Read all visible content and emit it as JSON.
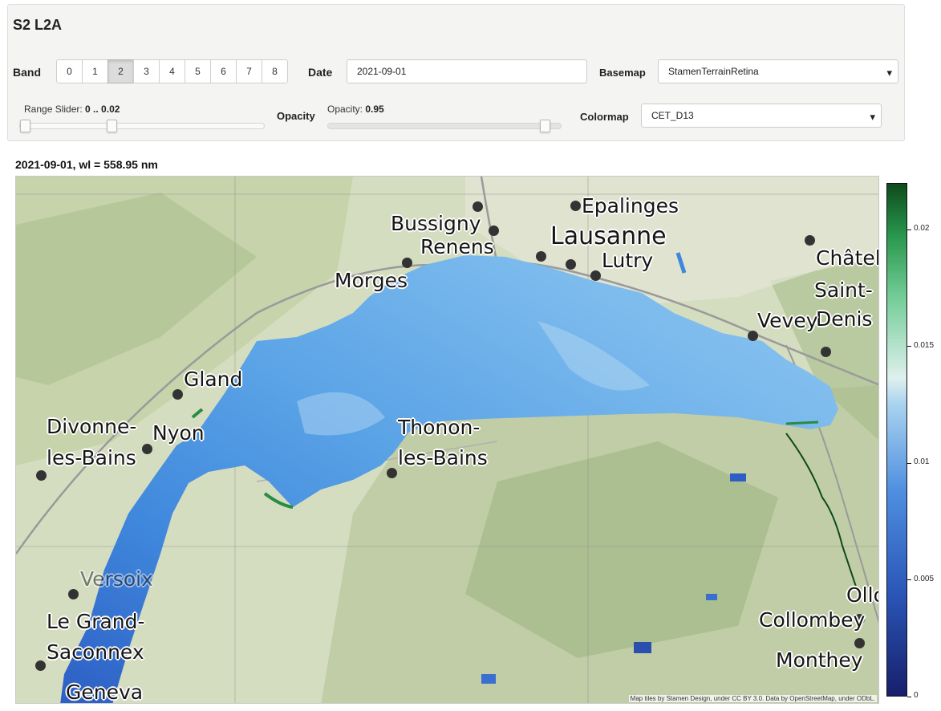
{
  "panel": {
    "title": "S2 L2A",
    "band_label": "Band",
    "bands": [
      "0",
      "1",
      "2",
      "3",
      "4",
      "5",
      "6",
      "7",
      "8"
    ],
    "selected_band": "2",
    "date_label": "Date",
    "date_value": "2021-09-01",
    "basemap_label": "Basemap",
    "basemap_value": "StamenTerrainRetina",
    "range_label": "Range Slider: ",
    "range_value": "0 .. 0.02",
    "opacity_label": "Opacity",
    "opacity_slider_label": "Opacity: ",
    "opacity_value": "0.95",
    "opacity_fraction": 0.95,
    "colormap_label": "Colormap",
    "colormap_value": "CET_D13"
  },
  "figure": {
    "title": "2021-09-01, wl = 558.95 nm",
    "places": [
      "Epalinges",
      "Bussigny",
      "Renens",
      "Lausanne",
      "Lutry",
      "Morges",
      "Châtel-",
      "Saint-",
      "Denis",
      "Vevey",
      "Gland",
      "Divonne-",
      "les-Bains",
      "Nyon",
      "Thonon-",
      "les-Bains",
      "Versoix",
      "Le Grand-",
      "Saconnex",
      "Geneva",
      "Collombey",
      "Monthey",
      "Ollon"
    ],
    "attribution": "Map tiles by Stamen Design, under CC BY 3.0. Data by OpenStreetMap, under ODbL."
  },
  "colorbar": {
    "colormap": "CET_D13",
    "min": 0,
    "max": 0.022,
    "ticks": [
      "0.02",
      "0.015",
      "0.01",
      "0.005",
      "0"
    ],
    "colors": [
      "#171f6b",
      "#2a56b8",
      "#4f8fe0",
      "#a9d3ef",
      "#dff0ee",
      "#72cc96",
      "#28964c",
      "#0e4a1c"
    ]
  }
}
